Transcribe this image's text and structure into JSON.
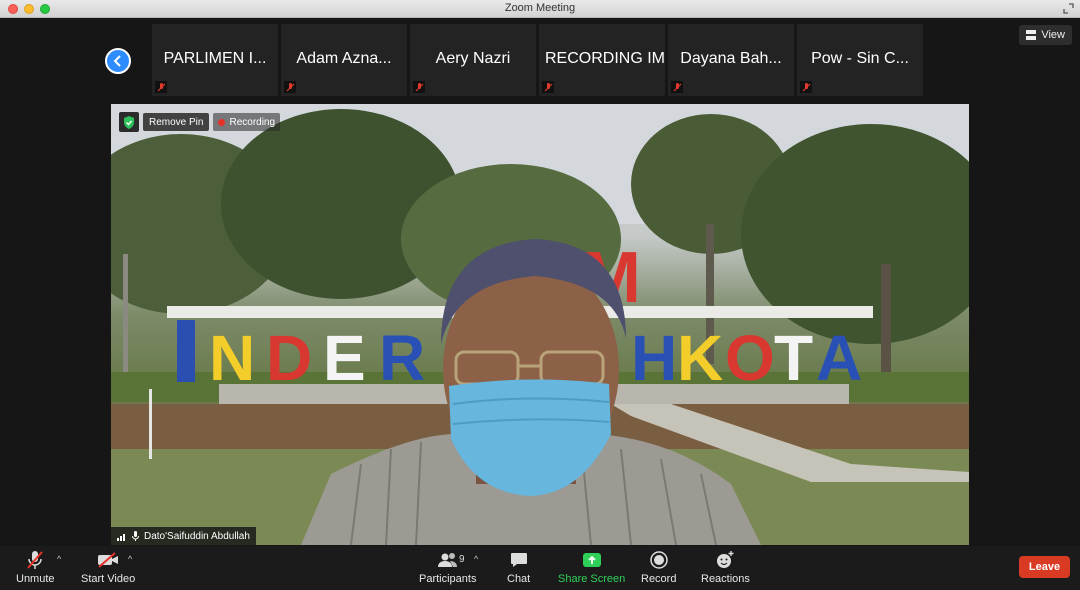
{
  "window": {
    "title": "Zoom Meeting"
  },
  "view_button": {
    "label": "View"
  },
  "participants_strip": [
    {
      "name": "PARLIMEN I..."
    },
    {
      "name": "Adam Azna..."
    },
    {
      "name": "Aery Nazri"
    },
    {
      "name": "RECORDING IM"
    },
    {
      "name": "Dayana Bah..."
    },
    {
      "name": "Pow - Sin C..."
    }
  ],
  "video": {
    "remove_pin_label": "Remove Pin",
    "recording_label": "Recording",
    "speaker_name": "Dato'Saifuddin Abdullah",
    "sign_text": "INDERA MAHKOTA",
    "sign_colors": [
      "#2950b5",
      "#f4cf2b",
      "#d8382f",
      "#ffffff",
      "#2950b5",
      "#d8382f",
      "#2950b5",
      "#f4cf2b",
      "#d8382f",
      "#ffffff",
      "#2950b5"
    ]
  },
  "toolbar": {
    "unmute": "Unmute",
    "start_video": "Start Video",
    "participants": "Participants",
    "participant_count": "9",
    "chat": "Chat",
    "share_screen": "Share Screen",
    "record": "Record",
    "reactions": "Reactions",
    "leave": "Leave"
  },
  "colors": {
    "accent": "#2d8cff",
    "share_green": "#2fd058",
    "leave_red": "#d93a24"
  }
}
